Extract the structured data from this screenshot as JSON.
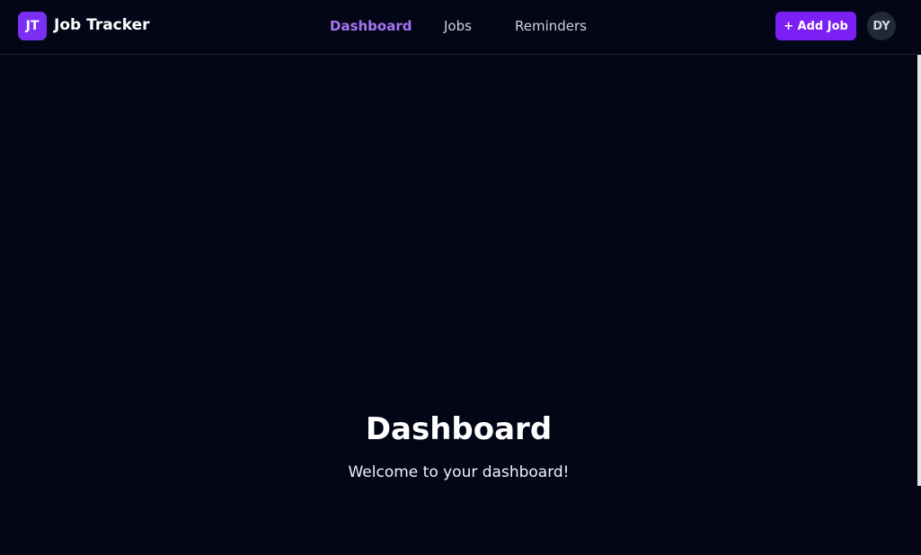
{
  "app": {
    "logo_initials": "JT",
    "title": "Job Tracker"
  },
  "nav": {
    "items": [
      {
        "label": "Dashboard",
        "active": true
      },
      {
        "label": "Jobs",
        "active": false
      },
      {
        "label": "Reminders",
        "active": false
      }
    ]
  },
  "header_actions": {
    "add_job_label": "+ Add Job",
    "user_initials": "DY"
  },
  "main": {
    "heading": "Dashboard",
    "welcome": "Welcome to your dashboard!"
  },
  "colors": {
    "background": "#030616",
    "accent": "#7b1ff5",
    "active_nav": "#a675f5"
  }
}
